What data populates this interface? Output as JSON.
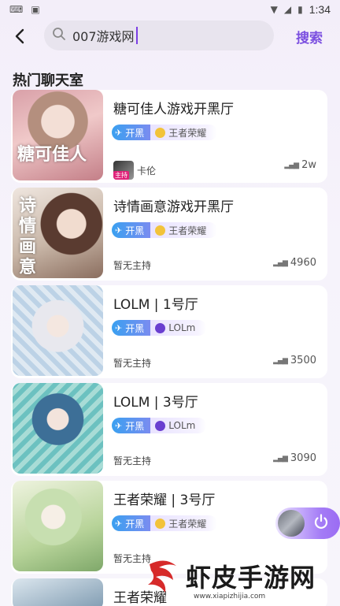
{
  "status": {
    "time": "1:34"
  },
  "search": {
    "query": "007游戏网",
    "button": "搜索"
  },
  "section": {
    "title": "热门聊天室"
  },
  "rooms": [
    {
      "name": "糖可佳人游戏开黑厅",
      "tag_a": "开黑",
      "tag_b": "王者荣耀",
      "host": "卡伦",
      "host_badge": "主持",
      "count": "2w",
      "thumb_text": "糖可佳人"
    },
    {
      "name": "诗情画意游戏开黑厅",
      "tag_a": "开黑",
      "tag_b": "王者荣耀",
      "host": "暂无主持",
      "count": "4960",
      "thumb_text": "诗情画意"
    },
    {
      "name": "LOLM | 1号厅",
      "tag_a": "开黑",
      "tag_b": "LOLm",
      "host": "暂无主持",
      "count": "3500"
    },
    {
      "name": "LOLM | 3号厅",
      "tag_a": "开黑",
      "tag_b": "LOLm",
      "host": "暂无主持",
      "count": "3090"
    },
    {
      "name": "王者荣耀 | 3号厅",
      "tag_a": "开黑",
      "tag_b": "王者荣耀",
      "host": "暂无主持"
    },
    {
      "name": "王者荣耀"
    }
  ],
  "watermark": {
    "text": "虾皮手游网",
    "url": "www.xiapizhijia.com"
  },
  "colors": {
    "accent": "#7b4fe0",
    "tag_blue": "#3aa0f0",
    "background": "#f3eef9"
  }
}
